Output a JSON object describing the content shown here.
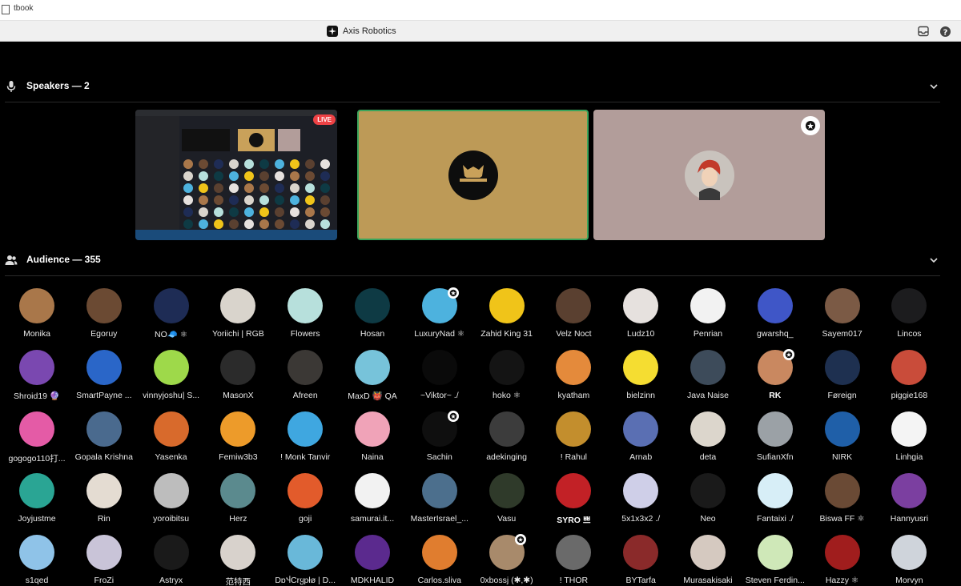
{
  "browser_tab": {
    "title": "tbook"
  },
  "window": {
    "title": "Axis Robotics"
  },
  "speakers": {
    "label": "Speakers — 2",
    "live_badge": "LIVE"
  },
  "audience": {
    "label": "Audience — 355",
    "members": [
      {
        "name": "Monika",
        "color": "#a9774a",
        "bold": false,
        "badge": false
      },
      {
        "name": "Egoruy",
        "color": "#6b4a33",
        "bold": false,
        "badge": false
      },
      {
        "name": "NO🧢 ⚛",
        "color": "#1e2c55",
        "bold": false,
        "badge": false
      },
      {
        "name": "Yoriichi | RGB",
        "color": "#d9d4cc",
        "bold": false,
        "badge": false
      },
      {
        "name": "Flowers",
        "color": "#b7e0dc",
        "bold": false,
        "badge": false
      },
      {
        "name": "Hosan",
        "color": "#0e3a44",
        "bold": false,
        "badge": false
      },
      {
        "name": "LuxuryNad ⚛",
        "color": "#4db2de",
        "bold": false,
        "badge": true
      },
      {
        "name": "Zahid King 31",
        "color": "#f0c419",
        "bold": false,
        "badge": false
      },
      {
        "name": "Velz Noct",
        "color": "#5a4030",
        "bold": false,
        "badge": false
      },
      {
        "name": "Ludz10",
        "color": "#e6e1de",
        "bold": false,
        "badge": false
      },
      {
        "name": "Penrian",
        "color": "#f2f2f2",
        "bold": false,
        "badge": false
      },
      {
        "name": "gwarshq_",
        "color": "#3f56c7",
        "bold": false,
        "badge": false
      },
      {
        "name": "Sayem017",
        "color": "#7b5a45",
        "bold": false,
        "badge": false
      },
      {
        "name": "Lincos",
        "color": "#1c1c1e",
        "bold": false,
        "badge": false
      },
      {
        "name": "Shroid19 🔮",
        "color": "#7a48b0",
        "bold": false,
        "badge": false
      },
      {
        "name": "SmartPayne ...",
        "color": "#2a66c8",
        "bold": false,
        "badge": false
      },
      {
        "name": "vinnyjoshu| S...",
        "color": "#9ed94a",
        "bold": false,
        "badge": false
      },
      {
        "name": "MasonX",
        "color": "#2b2b2b",
        "bold": false,
        "badge": false
      },
      {
        "name": "Afreen",
        "color": "#3b3835",
        "bold": false,
        "badge": false
      },
      {
        "name": "MaxD 👹 QA",
        "color": "#77c3da",
        "bold": false,
        "badge": false
      },
      {
        "name": "~Viktor~ ./",
        "color": "#0a0a0a",
        "bold": false,
        "badge": false
      },
      {
        "name": "hoko ⚛",
        "color": "#141414",
        "bold": false,
        "badge": false
      },
      {
        "name": "kyatham",
        "color": "#e48a3b",
        "bold": false,
        "badge": false
      },
      {
        "name": "bielzinn",
        "color": "#f5dd31",
        "bold": false,
        "badge": false
      },
      {
        "name": "Java Naise",
        "color": "#3d4b5a",
        "bold": false,
        "badge": false
      },
      {
        "name": "RK",
        "color": "#c98860",
        "bold": true,
        "badge": true
      },
      {
        "name": "Føreign",
        "color": "#1e3050",
        "bold": false,
        "badge": false
      },
      {
        "name": "piggie168",
        "color": "#c94c3a",
        "bold": false,
        "badge": false
      },
      {
        "name": "gogogo110打...",
        "color": "#e45ba6",
        "bold": false,
        "badge": false
      },
      {
        "name": "Gopala Krishna",
        "color": "#4a6a8e",
        "bold": false,
        "badge": false
      },
      {
        "name": "Yasenka",
        "color": "#d86a2c",
        "bold": false,
        "badge": false
      },
      {
        "name": "Femiw3b3",
        "color": "#ed9b2a",
        "bold": false,
        "badge": false
      },
      {
        "name": "! Monk Tanvir",
        "color": "#3fa7e0",
        "bold": false,
        "badge": false
      },
      {
        "name": "Naina",
        "color": "#f0a3b8",
        "bold": false,
        "badge": false
      },
      {
        "name": "Sachin",
        "color": "#0f0f0f",
        "bold": false,
        "badge": true
      },
      {
        "name": "adekinging",
        "color": "#3c3c3c",
        "bold": false,
        "badge": false
      },
      {
        "name": "! Rahul",
        "color": "#c38e2d",
        "bold": false,
        "badge": false
      },
      {
        "name": "Arnab",
        "color": "#5a6fb3",
        "bold": false,
        "badge": false
      },
      {
        "name": "deta",
        "color": "#dcd6cc",
        "bold": false,
        "badge": false
      },
      {
        "name": "SufianXfn",
        "color": "#9ba1a6",
        "bold": false,
        "badge": false
      },
      {
        "name": "NIRK",
        "color": "#1f5fa8",
        "bold": false,
        "badge": false
      },
      {
        "name": "Linhgia",
        "color": "#f4f4f4",
        "bold": false,
        "badge": false
      },
      {
        "name": "Joyjustme",
        "color": "#2aa594",
        "bold": false,
        "badge": false
      },
      {
        "name": "Rin",
        "color": "#e4dcd2",
        "bold": false,
        "badge": false
      },
      {
        "name": "yoroibitsu",
        "color": "#bdbdbd",
        "bold": false,
        "badge": false
      },
      {
        "name": "Herz",
        "color": "#5b8a8e",
        "bold": false,
        "badge": false
      },
      {
        "name": "goji",
        "color": "#e25b2b",
        "bold": false,
        "badge": false
      },
      {
        "name": "samurai.it...",
        "color": "#f2f2f2",
        "bold": false,
        "badge": false
      },
      {
        "name": "MasterIsrael_...",
        "color": "#4c6f8d",
        "bold": false,
        "badge": false
      },
      {
        "name": "Vasu",
        "color": "#2f3a2a",
        "bold": false,
        "badge": false
      },
      {
        "name": "SYRO 쁘",
        "color": "#c22126",
        "bold": true,
        "badge": false
      },
      {
        "name": "5x1x3x2 ./",
        "color": "#cfcfe8",
        "bold": false,
        "badge": false
      },
      {
        "name": "Neo",
        "color": "#1a1a1a",
        "bold": false,
        "badge": false
      },
      {
        "name": "Fantaixi ./",
        "color": "#d7eef7",
        "bold": false,
        "badge": false
      },
      {
        "name": "Biswa FF ⚛",
        "color": "#6a4a35",
        "bold": false,
        "badge": false
      },
      {
        "name": "Hannyusri",
        "color": "#7b3fa0",
        "bold": false,
        "badge": false
      },
      {
        "name": "s1qed",
        "color": "#8fc3e8",
        "bold": false,
        "badge": false
      },
      {
        "name": "FroZi",
        "color": "#c9c4d8",
        "bold": false,
        "badge": false
      },
      {
        "name": "Astryx",
        "color": "#1a1a1a",
        "bold": false,
        "badge": false
      },
      {
        "name": "范特西",
        "color": "#d8d2cc",
        "bold": false,
        "badge": false
      },
      {
        "name": "DɒჃCrყpłø | D...",
        "color": "#69b8d9",
        "bold": false,
        "badge": false
      },
      {
        "name": "MDKHALID",
        "color": "#5b2a8e",
        "bold": false,
        "badge": false
      },
      {
        "name": "Carlos.sliva",
        "color": "#e07d2f",
        "bold": false,
        "badge": false
      },
      {
        "name": "0xbossj (✱,✱)",
        "color": "#a88a6b",
        "bold": false,
        "badge": true
      },
      {
        "name": "! THOR",
        "color": "#6a6a6a",
        "bold": false,
        "badge": false
      },
      {
        "name": "BYTarfa",
        "color": "#8a2a2a",
        "bold": false,
        "badge": false
      },
      {
        "name": "Murasakisaki",
        "color": "#d5c9c0",
        "bold": false,
        "badge": false
      },
      {
        "name": "Steven Ferdin...",
        "color": "#cfe8b8",
        "bold": false,
        "badge": false
      },
      {
        "name": "Hazzy ⚛",
        "color": "#a01d1d",
        "bold": false,
        "badge": false
      },
      {
        "name": "Morvyn",
        "color": "#cfd4db",
        "bold": false,
        "badge": false
      }
    ]
  },
  "colors": {
    "accent_speaking": "#3ba55c",
    "live": "#ed4245"
  }
}
